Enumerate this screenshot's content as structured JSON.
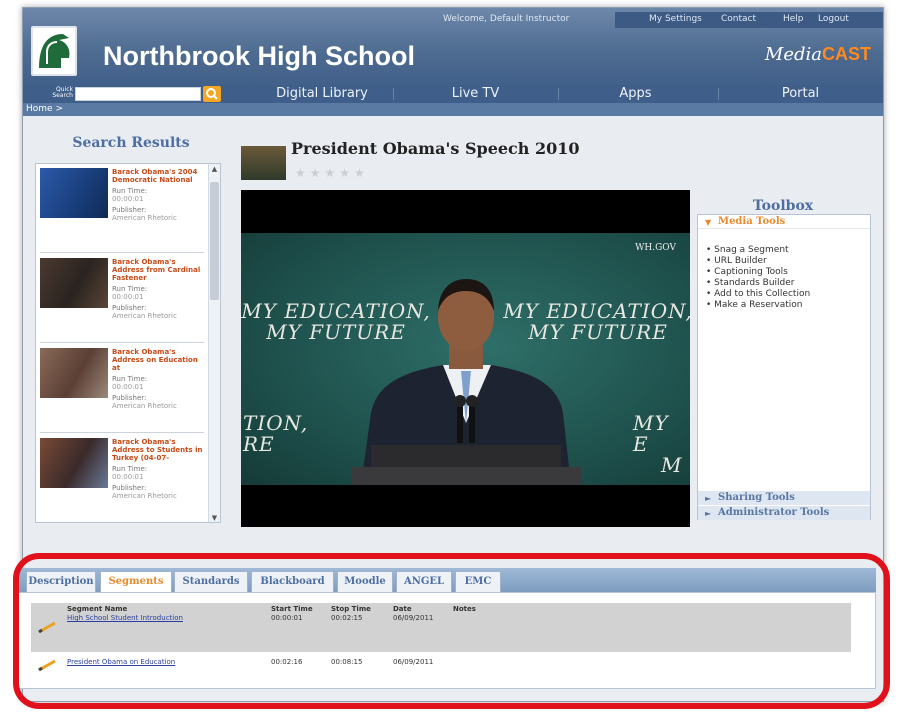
{
  "header": {
    "welcome": "Welcome, Default Instructor",
    "links": [
      "My Settings",
      "Contact",
      "Help",
      "Logout"
    ],
    "school_name": "Northbrook High School",
    "brand_prefix": "Media",
    "brand_suffix": "CAST"
  },
  "search": {
    "label_line1": "Quick",
    "label_line2": "Search",
    "placeholder": ""
  },
  "nav": {
    "items": [
      "Digital Library",
      "Live TV",
      "Apps",
      "Portal"
    ]
  },
  "breadcrumb": "Home >",
  "results": {
    "title": "Search Results",
    "items": [
      {
        "title": "Barack Obama's 2004 Democratic National",
        "runtime_label": "Run Time:",
        "runtime": "00:00:01",
        "publisher_label": "Publisher:",
        "publisher": "American Rhetoric"
      },
      {
        "title": "Barack Obama's Address from Cardinal Fastener",
        "runtime_label": "Run Time:",
        "runtime": "00:00:01",
        "publisher_label": "Publisher:",
        "publisher": "American Rhetoric"
      },
      {
        "title": "Barack Obama's Address on Education at",
        "runtime_label": "Run Time:",
        "runtime": "00:00:01",
        "publisher_label": "Publisher:",
        "publisher": "American Rhetoric"
      },
      {
        "title": "Barack Obama's Address to Students in Turkey (04-07-",
        "runtime_label": "Run Time:",
        "runtime": "00:00:01",
        "publisher_label": "Publisher:",
        "publisher": "American Rhetoric"
      }
    ]
  },
  "video": {
    "title": "President Obama's Speech 2010",
    "rating_stars": "★★★★★",
    "slogan_line1": "MY EDUCATION,",
    "slogan_line2": "MY FUTURE",
    "fragment1_line1": "TION,",
    "fragment1_line2": "RE",
    "fragment2": "N,",
    "fragment3_line1": "MY E",
    "fragment3_line2": "M",
    "watermark": "WH.GOV"
  },
  "toolbox": {
    "title": "Toolbox",
    "media_tools": "Media Tools",
    "media_items": [
      "Snag a Segment",
      "URL Builder",
      "Captioning Tools",
      "Standards Builder",
      "Add to this Collection",
      "Make a Reservation"
    ],
    "sharing_tools": "Sharing Tools",
    "admin_tools": "Administrator Tools"
  },
  "tabs": {
    "items": [
      "Description",
      "Segments",
      "Standards",
      "Blackboard",
      "Moodle",
      "ANGEL",
      "EMC"
    ],
    "active": "Segments"
  },
  "segments": {
    "headers": {
      "name": "Segment Name",
      "start": "Start Time",
      "stop": "Stop Time",
      "date": "Date",
      "notes": "Notes"
    },
    "rows": [
      {
        "name": "High School Student Introduction",
        "start": "00:00:01",
        "stop": "00:02:15",
        "date": "06/09/2011",
        "notes": ""
      },
      {
        "name": "President Obama on Education",
        "start": "00:02:16",
        "stop": "00:08:15",
        "date": "06/09/2011",
        "notes": ""
      }
    ]
  },
  "colors": {
    "accent": "#e98a2c",
    "header_blue": "#4d6a90",
    "highlight_ring": "#e0111b"
  }
}
